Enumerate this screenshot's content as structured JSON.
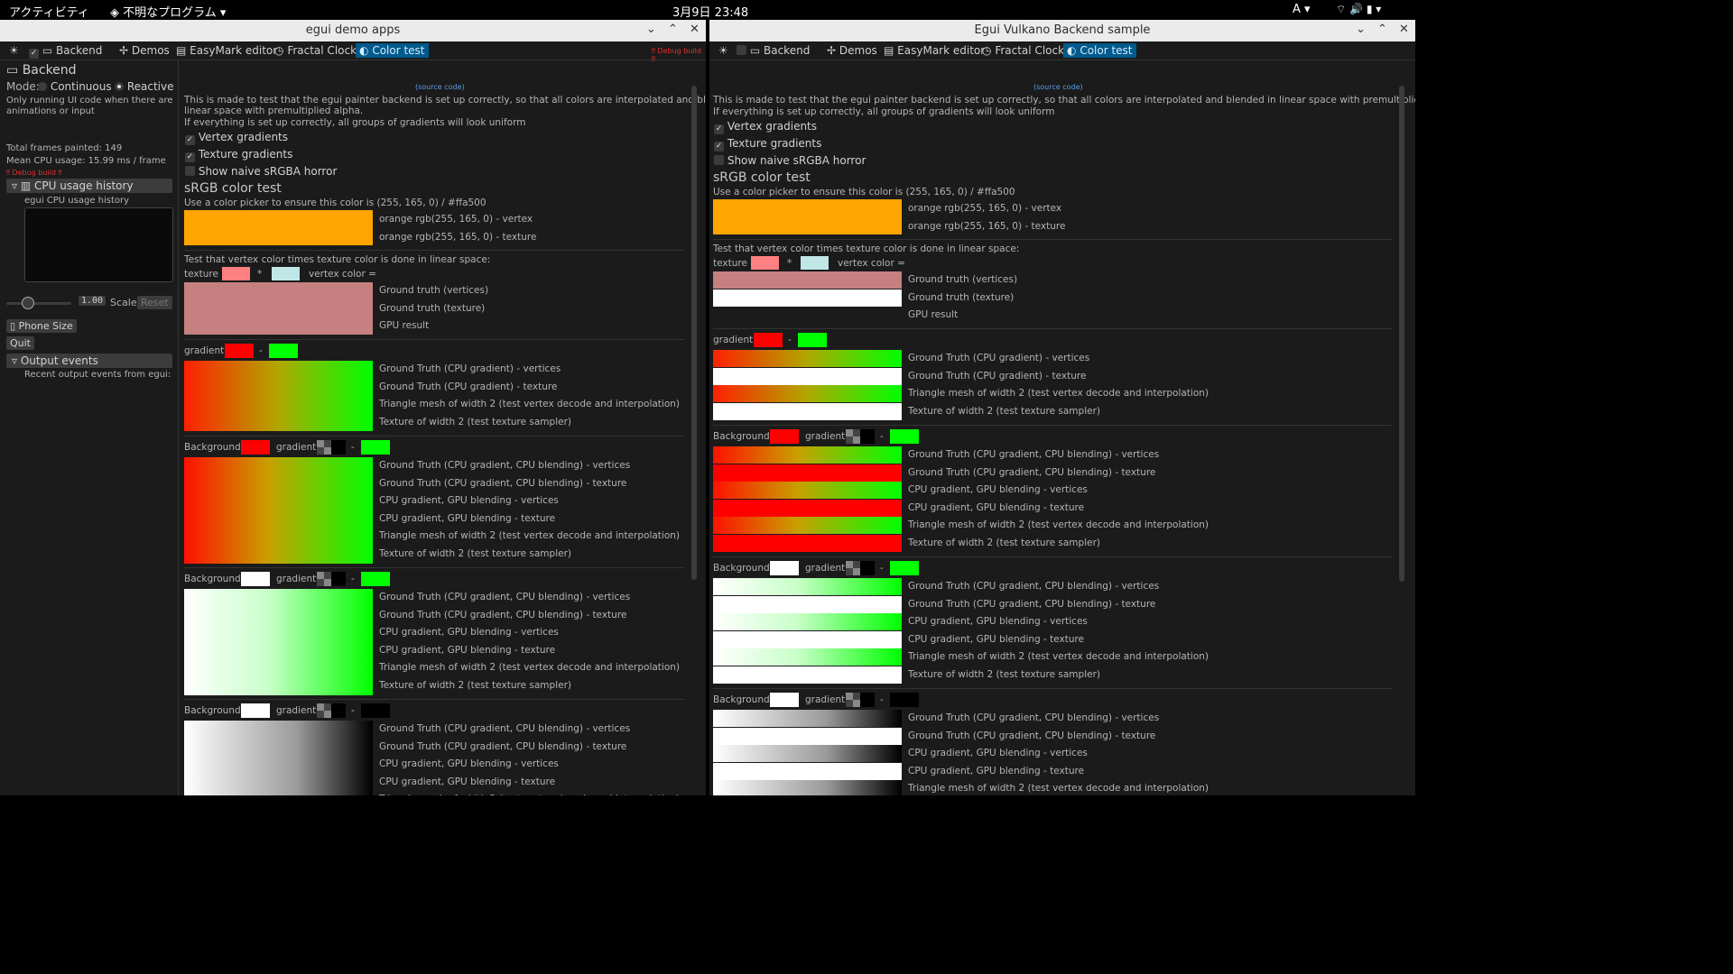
{
  "topbar": {
    "activities": "アクティビティ",
    "app": "不明なプログラム",
    "clock": "3月9日  23:48",
    "input": "A"
  },
  "left_window": {
    "title": "egui demo apps",
    "debug_build": "‼ Debug build ‼",
    "menu": {
      "backend": "Backend",
      "demos": "Demos",
      "easymark": "EasyMark editor",
      "fractal": "Fractal Clock",
      "color_test": "Color test"
    },
    "side": {
      "title": "Backend",
      "mode_label": "Mode:",
      "mode_continuous": "Continuous",
      "mode_reactive": "Reactive",
      "mode_note_1": "Only running UI code when there are",
      "mode_note_2": "animations or input",
      "frames": "Total frames painted: 149",
      "cpu": "Mean CPU usage: 15.99 ms / frame",
      "debug_build": "‼ Debug build ‼",
      "cpu_history": "CPU usage history",
      "cpu_history_label": "egui CPU usage history",
      "scale_value": "1.00",
      "scale_label": "Scale",
      "reset": "Reset",
      "phone_size": "Phone Size",
      "quit": "Quit",
      "output_events": "Output events",
      "output_note": "Recent output events from egui:"
    }
  },
  "right_window": {
    "title": "Egui Vulkano Backend sample"
  },
  "color_test": {
    "source_code": "(source code)",
    "intro_left_1": "This is made to test that the egui painter backend is set up correctly, so that all colors are interpolated and blended in",
    "intro_left_2": "linear space with premultiplied alpha.",
    "intro_right_1": "This is made to test that the egui painter backend is set up correctly, so that all colors are interpolated and blended in linear space with premultiplied alpha.",
    "intro_2": "If everything is set up correctly, all groups of gradients will look uniform",
    "vertex_gradients": "Vertex gradients",
    "texture_gradients": "Texture gradients",
    "naive": "Show naive sRGBA horror",
    "srgb_title": "sRGB color test",
    "srgb_note": "Use a color picker to ensure this color is (255, 165, 0) / #ffa500",
    "orange_vertex": "orange rgb(255, 165, 0) - vertex",
    "orange_texture": "orange rgb(255, 165, 0) - texture",
    "mult_note": "Test that vertex color times texture color is done in linear space:",
    "texture": "texture",
    "times": "*",
    "vertex_color": "vertex color =",
    "gt_vertices": "Ground truth (vertices)",
    "gt_texture": "Ground truth (texture)",
    "gpu_result": "GPU result",
    "gradient": "gradient",
    "dash": "-",
    "background": "Background:",
    "g1": "Ground Truth (CPU gradient) - vertices",
    "g2": "Ground Truth (CPU gradient) - texture",
    "g3": "Triangle mesh of width 2 (test vertex decode and interpolation)",
    "g4": "Texture of width 2 (test texture sampler)",
    "b1": "Ground Truth (CPU gradient, CPU blending) - vertices",
    "b2": "Ground Truth (CPU gradient, CPU blending) - texture",
    "b3": "CPU gradient, GPU blending - vertices",
    "b4": "CPU gradient, GPU blending - texture",
    "b5": "Triangle mesh of width 2 (test vertex decode and interpolation)",
    "b6": "Texture of width 2 (test texture sampler)"
  },
  "colors": {
    "orange": "#ffa500",
    "accent": "#005a8c"
  }
}
